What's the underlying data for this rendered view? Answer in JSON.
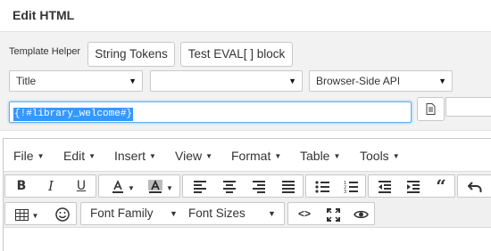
{
  "dialog": {
    "title": "Edit HTML"
  },
  "template_helper": {
    "label": "Template Helper",
    "string_tokens_button": "String Tokens",
    "test_eval_button": "Test EVAL[ ] block",
    "select_1_value": "Title",
    "select_2_value": "",
    "select_3_value": "Browser-Side API",
    "token_value": "{!#library_welcome#}"
  },
  "editor": {
    "menus": [
      "File",
      "Edit",
      "Insert",
      "View",
      "Format",
      "Table",
      "Tools"
    ],
    "font_family_label": "Font Family",
    "font_sizes_label": "Font Sizes"
  },
  "colors": {
    "accent": "#66afe9",
    "selection": "#3399ff",
    "toolbar_bg": "#f0f0f0"
  }
}
